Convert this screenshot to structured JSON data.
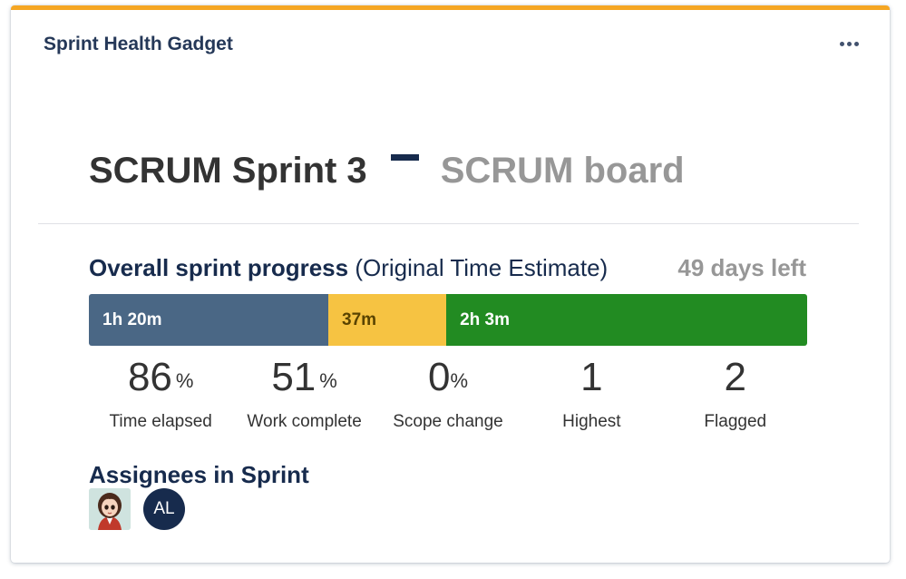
{
  "gadget": {
    "title": "Sprint Health Gadget",
    "menu_icon": "more-horizontal-icon",
    "accent_color": "#f5a623"
  },
  "sprint": {
    "name": "SCRUM Sprint 3",
    "separator": "–",
    "board": "SCRUM board"
  },
  "progress": {
    "heading": "Overall sprint progress",
    "subheading": "(Original Time Estimate)",
    "days_left": "49 days left",
    "segments": [
      {
        "label": "1h 20m",
        "status": "done",
        "color": "#4a6785"
      },
      {
        "label": "37m",
        "status": "in-progress",
        "color": "#f6c342"
      },
      {
        "label": "2h 3m",
        "status": "to-do",
        "color": "#228b22"
      }
    ]
  },
  "stats": [
    {
      "value": "86",
      "unit": "%",
      "label": "Time elapsed"
    },
    {
      "value": "51",
      "unit": "%",
      "label": "Work complete"
    },
    {
      "value": "0",
      "unit": "%",
      "label": "Scope change"
    },
    {
      "value": "1",
      "unit": "",
      "label": "Highest"
    },
    {
      "value": "2",
      "unit": "",
      "label": "Flagged"
    }
  ],
  "assignees": {
    "heading": "Assignees in Sprint",
    "users": [
      {
        "type": "photo",
        "icon": "user-photo-avatar"
      },
      {
        "type": "initials",
        "initials": "AL",
        "color": "#172b4d"
      }
    ]
  }
}
